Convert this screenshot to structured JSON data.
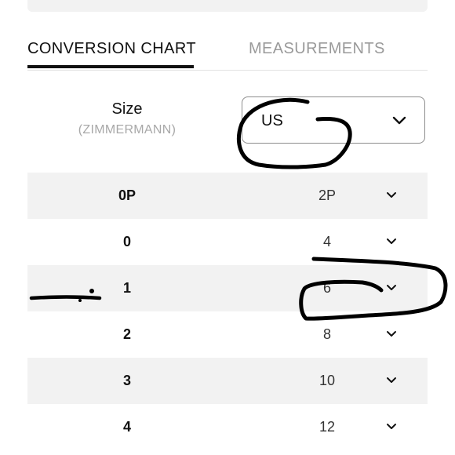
{
  "tabs": {
    "conversion_chart": "CONVERSION CHART",
    "measurements": "MEASUREMENTS"
  },
  "size_header": {
    "label": "Size",
    "brand": "(ZIMMERMANN)"
  },
  "region_select": {
    "value": "US",
    "icon": "chevron-down-icon"
  },
  "rows": [
    {
      "size": "0P",
      "converted": "2P"
    },
    {
      "size": "0",
      "converted": "4"
    },
    {
      "size": "1",
      "converted": "6"
    },
    {
      "size": "2",
      "converted": "8"
    },
    {
      "size": "3",
      "converted": "10"
    },
    {
      "size": "4",
      "converted": "12"
    }
  ],
  "colors": {
    "active_tab": "#111111",
    "inactive_tab": "#9a9a9a",
    "row_alt_bg": "#f2f2f2",
    "annotation_ink": "#000000"
  }
}
